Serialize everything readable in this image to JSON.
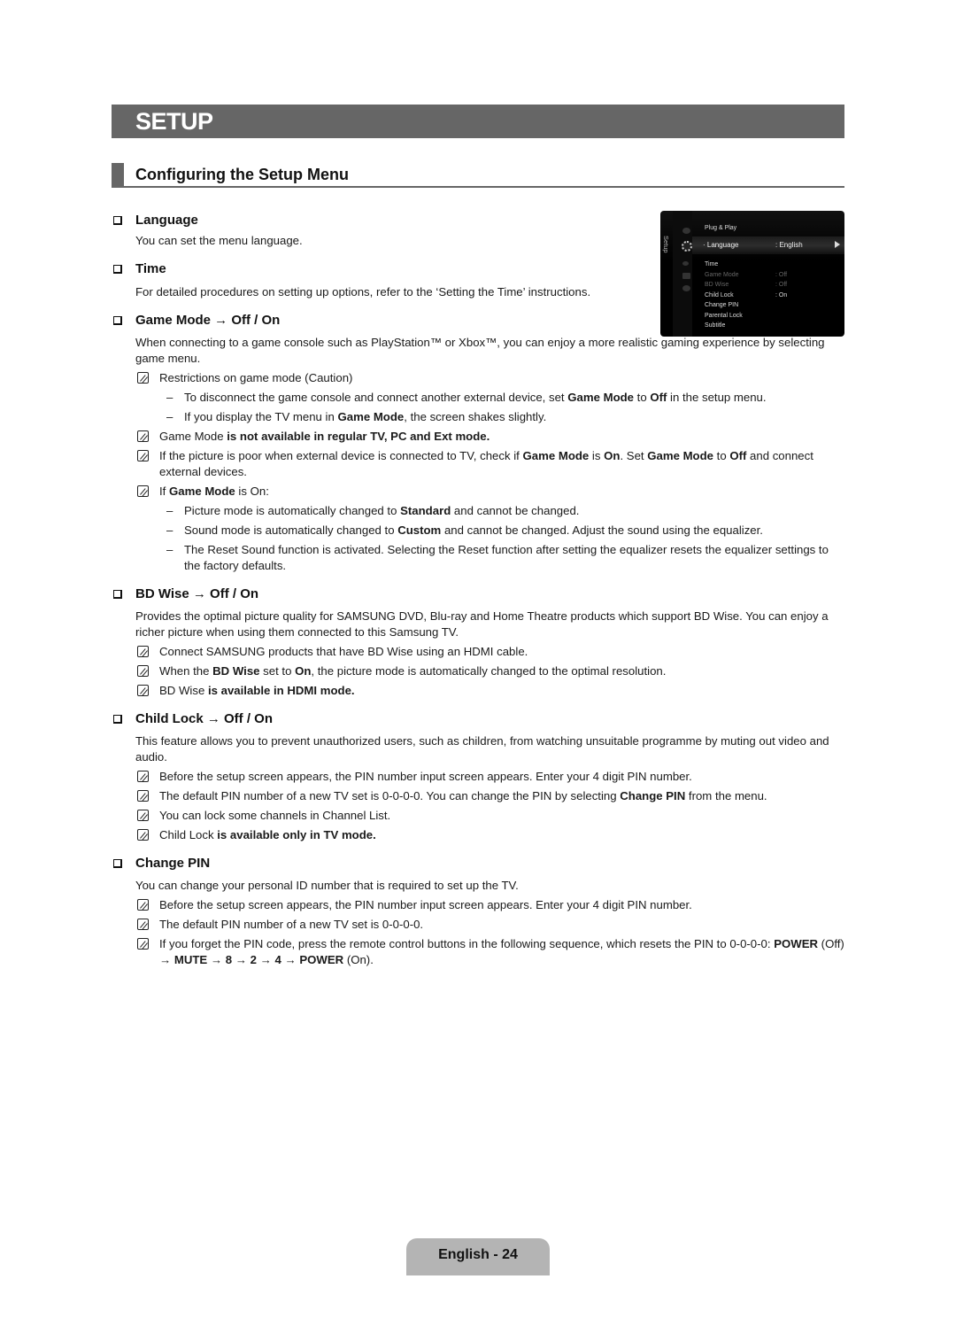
{
  "chapter_title": "SETUP",
  "section_title": "Configuring the Setup Menu",
  "tv_menu": {
    "side_label": "Setup",
    "rows": [
      {
        "label": "Plug & Play",
        "value": "",
        "state": "normal"
      },
      {
        "label": "Language",
        "value": ": English",
        "state": "selected"
      },
      {
        "label": "Time",
        "value": "",
        "state": "normal"
      },
      {
        "label": "Game Mode",
        "value": ": Off",
        "state": "disabled"
      },
      {
        "label": "BD Wise",
        "value": ": Off",
        "state": "disabled"
      },
      {
        "label": "Child Lock",
        "value": ": On",
        "state": "normal"
      },
      {
        "label": "Change PIN",
        "value": "",
        "state": "normal"
      },
      {
        "label": "Parental Lock",
        "value": "",
        "state": "normal"
      },
      {
        "label": "Subtitle",
        "value": "",
        "state": "normal"
      }
    ]
  },
  "items": {
    "language": {
      "title": "Language",
      "text": "You can set the menu language."
    },
    "time": {
      "title": "Time",
      "text": "For detailed procedures on setting up options, refer to the ‘Setting the Time’ instructions."
    },
    "game_mode": {
      "title": "Game Mode → Off / On",
      "text": "When connecting to a game console such as PlayStation™ or Xbox™, you can enjoy a more realistic gaming experience by selecting game menu.",
      "note1": "Restrictions on game mode (Caution)",
      "note1_dash1": [
        "To disconnect the game console and connect another external device, set ",
        "Game Mode",
        " to ",
        "Off",
        " in the setup menu."
      ],
      "note1_dash2": [
        "If you display the TV menu in ",
        "Game Mode",
        ", the screen shakes slightly."
      ],
      "note2": [
        "Game Mode",
        " is not available in regular TV, PC and Ext mode."
      ],
      "note3": [
        "If the picture is poor when external device is connected to TV, check if ",
        "Game Mode",
        " is ",
        "On",
        ". Set ",
        "Game Mode",
        " to ",
        "Off",
        " and connect external devices."
      ],
      "note4": [
        "If ",
        "Game Mode",
        " is On:"
      ],
      "note4_dash1": [
        "Picture mode is automatically changed to ",
        "Standard",
        " and cannot be changed."
      ],
      "note4_dash2": [
        "Sound mode is automatically changed to ",
        "Custom",
        " and cannot be changed. Adjust the sound using the equalizer."
      ],
      "note4_dash3": "The Reset Sound function is activated. Selecting the Reset function after setting the equalizer resets the equalizer settings to the factory defaults."
    },
    "bd_wise": {
      "title": "BD Wise → Off / On",
      "text": "Provides the optimal picture quality for SAMSUNG DVD, Blu-ray and Home Theatre products which support BD Wise. You can enjoy a richer picture when using them connected to this Samsung TV.",
      "note1": "Connect SAMSUNG products that have BD Wise using an HDMI cable.",
      "note2": [
        "When the ",
        "BD Wise",
        " set to ",
        "On",
        ", the picture mode is automatically changed to the optimal resolution."
      ],
      "note3": [
        "BD Wise",
        " is available in HDMI mode."
      ]
    },
    "child_lock": {
      "title": "Child Lock → Off / On",
      "text": "This feature allows you to prevent unauthorized users, such as children, from watching unsuitable programme by muting out video and audio.",
      "note1": "Before the setup screen appears, the PIN number input screen appears. Enter your 4 digit PIN number.",
      "note2": [
        "The default PIN number of a new TV set is 0-0-0-0. You can change the PIN by selecting ",
        "Change PIN",
        " from the menu."
      ],
      "note3": "You can lock some channels in Channel List.",
      "note4": [
        "Child Lock",
        " is available only in TV mode."
      ]
    },
    "change_pin": {
      "title": "Change PIN",
      "text": "You can change your personal ID number that is required to set up the TV.",
      "note1": "Before the setup screen appears, the PIN number input screen appears. Enter your 4 digit PIN number.",
      "note2": "The default PIN number of a new TV set is 0-0-0-0.",
      "note3": [
        "If you forget the PIN code, press the remote control buttons in the following sequence, which resets the PIN to 0-0-0-0: ",
        "POWER",
        " (Off) → ",
        "MUTE",
        " → ",
        "8",
        " → ",
        "2",
        " → ",
        "4",
        " → ",
        "POWER",
        " (On)."
      ]
    }
  },
  "footer": {
    "page_label": "English - 24"
  }
}
